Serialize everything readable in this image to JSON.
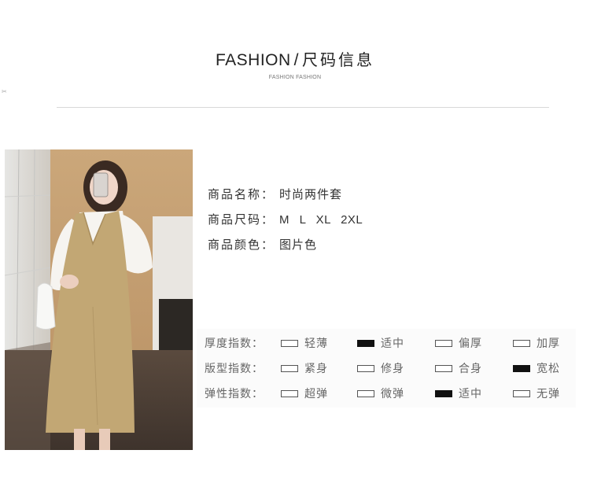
{
  "header": {
    "title_en": "FASHION",
    "separator": "/",
    "title_cn": "尺码信息",
    "subtitle": "FASHION FASHION"
  },
  "edge_mark": "✂",
  "product": {
    "name_label": "商品名称：",
    "name_value": "时尚两件套",
    "size_label": "商品尺码：",
    "size_value": "M L XL 2XL",
    "color_label": "商品颜色：",
    "color_value": "图片色"
  },
  "scales": [
    {
      "label": "厚度指数：",
      "options": [
        "轻薄",
        "适中",
        "偏厚",
        "加厚"
      ],
      "selected": "适中"
    },
    {
      "label": "版型指数：",
      "options": [
        "紧身",
        "修身",
        "合身",
        "宽松"
      ],
      "selected": "宽松"
    },
    {
      "label": "弹性指数：",
      "options": [
        "超弹",
        "微弹",
        "适中",
        "无弹"
      ],
      "selected": "适中"
    }
  ],
  "colors": {
    "selected_box": "#111111",
    "dress": "#c2a774",
    "shirt": "#f4f2ee"
  }
}
